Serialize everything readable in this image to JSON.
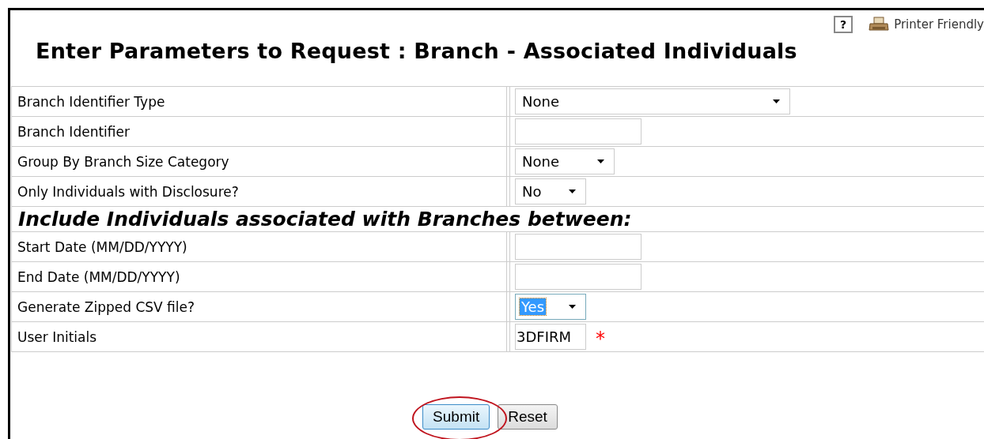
{
  "toolbar": {
    "help": "?",
    "printer_friendly": "Printer Friendly"
  },
  "title": "Enter Parameters to Request : Branch - Associated Individuals",
  "rows": [
    {
      "kind": "select",
      "label": "Branch Identifier Type",
      "value": "None"
    },
    {
      "kind": "text",
      "label": "Branch Identifier"
    },
    {
      "kind": "select",
      "label": "Group By Branch Size Category",
      "value": "None"
    },
    {
      "kind": "select",
      "label": "Only Individuals with Disclosure?",
      "value": "No"
    },
    {
      "kind": "heading",
      "label": "Include Individuals associated with Branches between:"
    },
    {
      "kind": "text",
      "label": "Start Date (MM/DD/YYYY)"
    },
    {
      "kind": "text",
      "label": "End Date (MM/DD/YYYY)"
    },
    {
      "kind": "select",
      "label": "Generate Zipped CSV file?",
      "value": "Yes",
      "focused": true
    },
    {
      "kind": "text",
      "label": "User Initials",
      "value": "3DFIRM",
      "required": "*"
    }
  ],
  "buttons": [
    {
      "label": "Submit",
      "circled": true
    },
    {
      "label": "Reset",
      "circled": false
    }
  ]
}
